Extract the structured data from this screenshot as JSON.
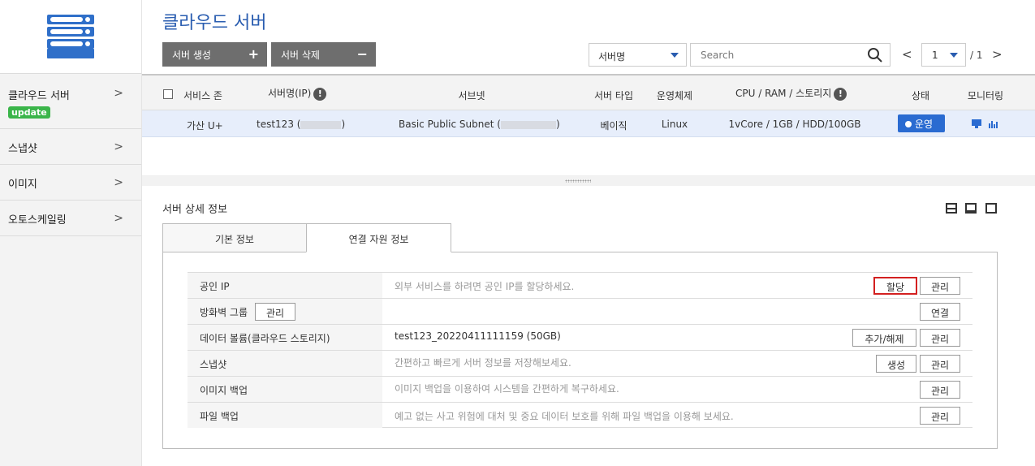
{
  "sidebar": {
    "items": [
      {
        "label": "클라우드 서버",
        "badge": "update"
      },
      {
        "label": "스냅샷"
      },
      {
        "label": "이미지"
      },
      {
        "label": "오토스케일링"
      }
    ],
    "chevron": ">"
  },
  "header": {
    "title": "클라우드 서버",
    "create_label": "서버 생성",
    "create_symbol": "+",
    "delete_label": "서버 삭제",
    "delete_symbol": "−",
    "filter_selected": "서버명",
    "search_placeholder": "Search",
    "pager": {
      "prev": "<",
      "next": ">",
      "page": "1",
      "total": "/ 1"
    }
  },
  "table": {
    "columns": [
      "서비스 존",
      "서버명(IP)",
      "서브넷",
      "서버 타입",
      "운영체제",
      "CPU / RAM / 스토리지",
      "상태",
      "모니터링"
    ],
    "info_symbol": "!",
    "rows": [
      {
        "zone": "가산 U+",
        "server_name": "test123 (",
        "server_name_close": ")",
        "subnet": "Basic Public Subnet (",
        "subnet_close": ")",
        "server_type": "베이직",
        "os": "Linux",
        "spec": "1vCore / 1GB / HDD/100GB",
        "status": "운영"
      }
    ]
  },
  "detail": {
    "title": "서버 상세 정보",
    "tabs": [
      "기본 정보",
      "연결 자원 정보"
    ],
    "active_tab": 1,
    "resources": [
      {
        "label": "공인 IP",
        "value": "외부 서비스를 하려면 공인 IP를 할당하세요.",
        "buttons": [
          "할당",
          "관리"
        ]
      },
      {
        "label": "방화벽 그룹",
        "inline_button": "관리",
        "value": "",
        "buttons": [
          "연결"
        ]
      },
      {
        "label": "데이터 볼륨(클라우드 스토리지)",
        "value": "test123_20220411111159 (50GB)",
        "buttons": [
          "추가/해제",
          "관리"
        ]
      },
      {
        "label": "스냅샷",
        "value": "간편하고 빠르게 서버 정보를 저장해보세요.",
        "buttons": [
          "생성",
          "관리"
        ]
      },
      {
        "label": "이미지 백업",
        "value": "이미지 백업을 이용하여 시스템을 간편하게 복구하세요.",
        "buttons": [
          "관리"
        ]
      },
      {
        "label": "파일 백업",
        "value": "예고 없는 사고 위험에 대처 및 중요 데이터 보호를 위해 파일 백업을 이용해 보세요.",
        "buttons": [
          "관리"
        ]
      }
    ]
  },
  "colors": {
    "accent": "#2a5db0",
    "status_running": "#2a6bd1",
    "badge_update": "#3bb54a",
    "highlight_border": "#d32020",
    "selected_row": "#e7eefb"
  },
  "icons": {
    "logo": "server-stack-icon",
    "search": "search-icon",
    "monitor": "monitor-icon",
    "chart": "bar-chart-icon"
  }
}
